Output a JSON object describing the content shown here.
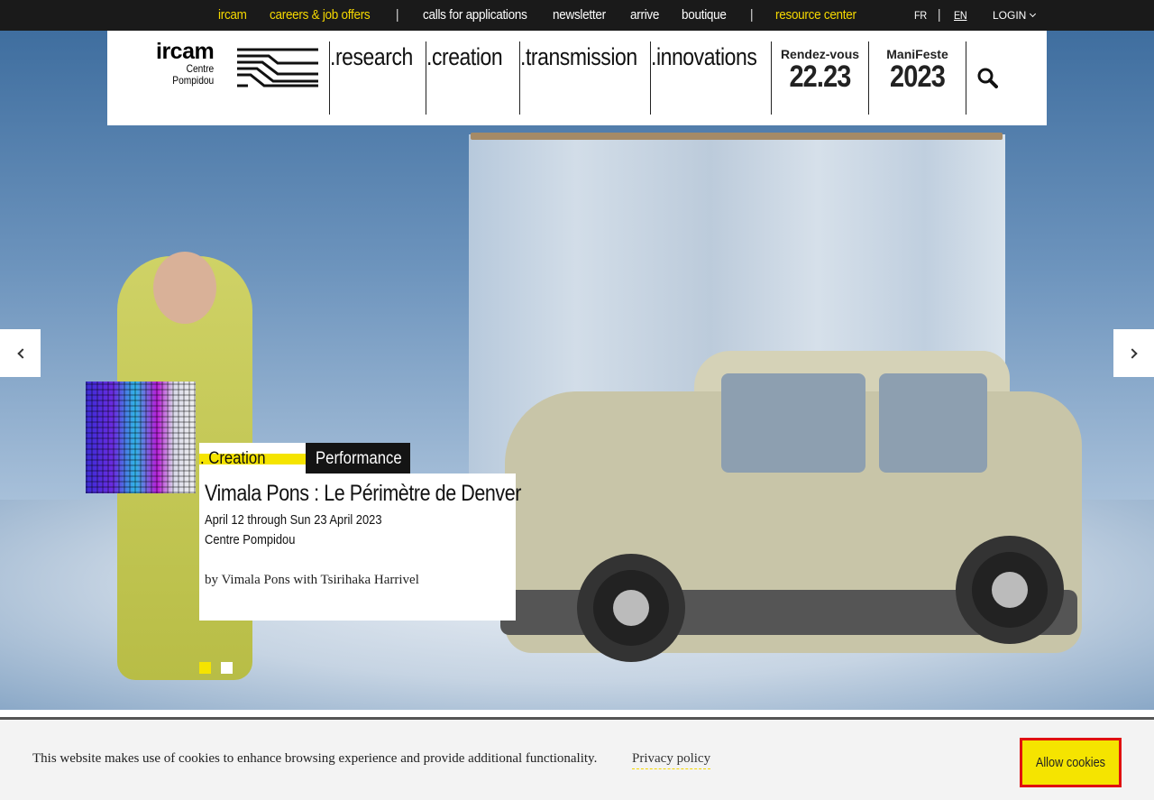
{
  "topbar": {
    "ircam": "ircam",
    "careers": "careers & job offers",
    "sep": "|",
    "calls": "calls for applications",
    "newsletter": "newsletter",
    "arrive": "arrive",
    "boutique": "boutique",
    "resource_center": "resource center",
    "lang_fr": "FR",
    "lang_en": "EN",
    "login": "LOGIN"
  },
  "header": {
    "logo_big": "ircam",
    "logo_line1": "Centre",
    "logo_line2": "Pompidou",
    "nav": [
      ".research",
      ".creation",
      ".transmission",
      ".innovations"
    ],
    "event1_top": "Rendez-vous",
    "event1_bottom": "22.23",
    "event2_top": "ManiFeste",
    "event2_bottom": "2023"
  },
  "slide": {
    "category": ". Creation",
    "type": "Performance",
    "title": "Vimala Pons : Le Périmètre de Denver",
    "dates": "April 12 through Sun 23 April 2023",
    "place": "Centre Pompidou",
    "byline": "by Vimala Pons with Tsirihaka Harrivel"
  },
  "carousel": {
    "active_index": 0,
    "count": 2
  },
  "cookie": {
    "text": "This website makes use of cookies to enhance browsing experience and provide additional functionality.",
    "privacy": "Privacy policy",
    "allow": "Allow cookies"
  },
  "colors": {
    "accent_yellow": "#f5e400",
    "topbar_bg": "#1a1a1a",
    "allow_border": "#e01010"
  }
}
